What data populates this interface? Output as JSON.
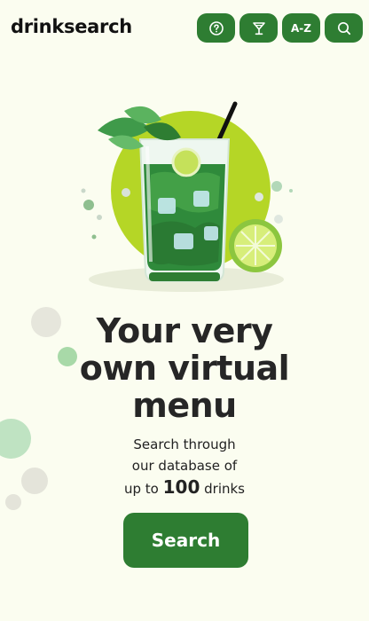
{
  "header": {
    "logo_text": "drinksearch",
    "nav": [
      {
        "label": "",
        "icon": "help-icon"
      },
      {
        "label": "",
        "icon": "cocktail-glass-icon"
      },
      {
        "label": "A-Z",
        "icon": ""
      },
      {
        "label": "",
        "icon": "search-icon"
      }
    ]
  },
  "hero": {
    "image": "mojito-cocktail-illustration"
  },
  "headline": {
    "line1": "Your very",
    "line2": "own virtual",
    "line3": "menu"
  },
  "subtext": {
    "line1": "Search through",
    "line2": "our database of",
    "line3_prefix": "up to ",
    "count": "100",
    "line3_suffix": " drinks"
  },
  "cta": {
    "label": "Search"
  },
  "colors": {
    "background": "#fbfdf0",
    "primary": "#2e7d32",
    "lime": "#b8d82a",
    "text": "#262626"
  }
}
